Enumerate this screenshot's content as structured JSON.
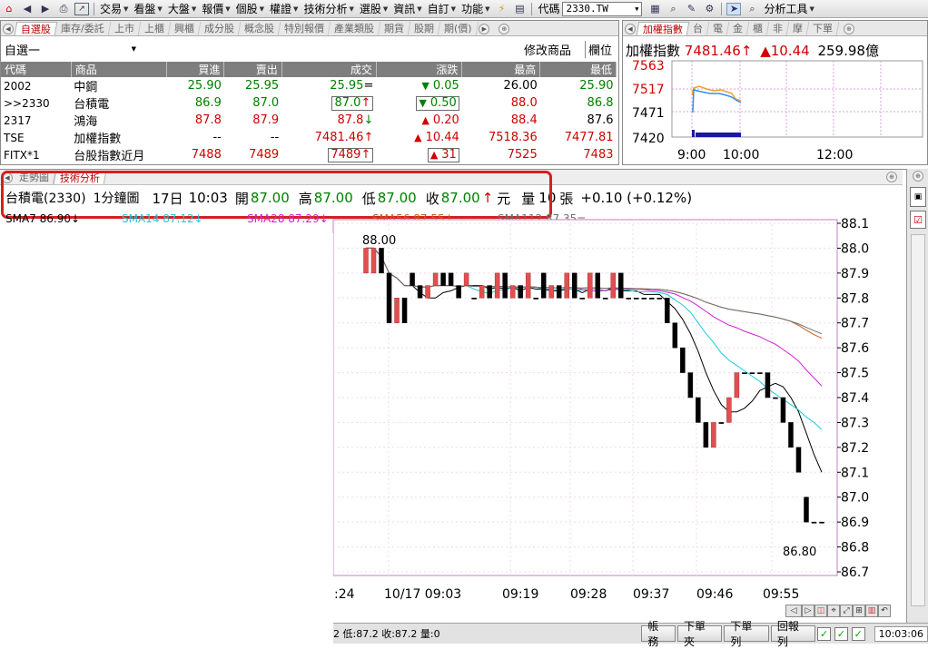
{
  "menubar": {
    "items": [
      "交易",
      "看盤",
      "大盤",
      "報價",
      "個股",
      "權證",
      "技術分析",
      "選股",
      "資訊",
      "自訂",
      "功能"
    ],
    "code_label": "代碼",
    "code_value": "2330.TW",
    "analysis_tools": "分析工具"
  },
  "watchlist": {
    "tabs": [
      "自選股",
      "庫存/委託",
      "上市",
      "上櫃",
      "興櫃",
      "成分股",
      "概念股",
      "特別報價",
      "產業類股",
      "期貨",
      "股期",
      "期(價)"
    ],
    "list_name": "自選一",
    "modify_button": "修改商品",
    "column_button": "欄位",
    "headers": [
      "代碼",
      "商品",
      "買進",
      "賣出",
      "成交",
      "漲跌",
      "最高",
      "最低"
    ],
    "rows": [
      {
        "code": "2002",
        "name": "中鋼",
        "bid": "25.90",
        "ask": "25.95",
        "last": "25.95",
        "last_sym": "=",
        "chg_arrow": "▼",
        "chg": "0.05",
        "high": "26.00",
        "low": "25.90",
        "c_bid": "g",
        "c_ask": "g",
        "c_last": "g",
        "c_chg": "g",
        "c_high": "k",
        "c_low": "g",
        "box_last": false,
        "box_chg": false
      },
      {
        "code": ">>2330",
        "name": "台積電",
        "bid": "86.9",
        "ask": "87.0",
        "last": "87.0",
        "last_sym": "↑",
        "chg_arrow": "▼",
        "chg": "0.50",
        "high": "88.0",
        "low": "86.8",
        "c_bid": "g",
        "c_ask": "g",
        "c_last": "g",
        "c_chg": "g",
        "c_high": "r",
        "c_low": "g",
        "box_last": true,
        "box_chg": true
      },
      {
        "code": "2317",
        "name": "鴻海",
        "bid": "87.8",
        "ask": "87.9",
        "last": "87.8",
        "last_sym": "↓",
        "chg_arrow": "▲",
        "chg": "0.20",
        "high": "88.4",
        "low": "87.6",
        "c_bid": "r",
        "c_ask": "r",
        "c_last": "r",
        "c_chg": "r",
        "c_high": "r",
        "c_low": "k",
        "box_last": false,
        "box_chg": false
      },
      {
        "code": "TSE",
        "name": "加權指數",
        "bid": "--",
        "ask": "--",
        "last": "7481.46",
        "last_sym": "↑",
        "chg_arrow": "▲",
        "chg": "10.44",
        "high": "7518.36",
        "low": "7477.81",
        "c_bid": "k",
        "c_ask": "k",
        "c_last": "r",
        "c_chg": "r",
        "c_high": "r",
        "c_low": "r",
        "box_last": false,
        "box_chg": false
      },
      {
        "code": "FITX*1",
        "name": "台股指數近月",
        "bid": "7488",
        "ask": "7489",
        "last": "7489",
        "last_sym": "↑",
        "chg_arrow": "▲",
        "chg": "31",
        "high": "7525",
        "low": "7483",
        "c_bid": "r",
        "c_ask": "r",
        "c_last": "r",
        "c_chg": "r",
        "c_high": "r",
        "c_low": "r",
        "box_last": true,
        "box_chg": true
      }
    ]
  },
  "index_panel": {
    "tabs": [
      "加權指數",
      "台",
      "電",
      "金",
      "櫃",
      "非",
      "摩",
      "下單"
    ],
    "title": "加權指數",
    "value": "7481.46",
    "arrow": "↑",
    "change": "▲10.44",
    "volume": "259.98億",
    "y_ticks": [
      "7563",
      "7517",
      "7471",
      "7420"
    ],
    "x_ticks": [
      "9:00",
      "10:00",
      "12:00"
    ]
  },
  "chart": {
    "tabs": [
      "走勢圖",
      "技術分析"
    ],
    "info": {
      "name": "台積電(2330)",
      "period": "1分鐘圖",
      "date": "17日",
      "time": "10:03",
      "open_label": "開",
      "open": "87.00",
      "high_label": "高",
      "high": "87.00",
      "low_label": "低",
      "low": "87.00",
      "close_label": "收",
      "close": "87.00",
      "unit": "元",
      "vol_label": "量",
      "vol": "10",
      "vol_unit": "張",
      "change": "+0.10 (+0.12%)"
    },
    "ma_legend": [
      "SMA7 86.90↓",
      "SMA14 87.12↓",
      "SMA28 87.29↓",
      "SMA56 87.55↓",
      "SMA112 87.35="
    ],
    "ma_colors": [
      "#000000",
      "#1ec8d8",
      "#d020d0",
      "#c06020",
      "#707070"
    ],
    "y_ticks": [
      "88.1",
      "88.0",
      "87.9",
      "87.8",
      "87.7",
      "87.6",
      "87.5",
      "87.4",
      "87.3",
      "87.2",
      "87.1",
      "87.0",
      "86.9",
      "86.8",
      "86.7"
    ],
    "x_ticks": [
      ":24",
      "10/17 09:03",
      "09:19",
      "09:28",
      "09:37",
      "09:46",
      "09:55"
    ],
    "high_label": "88.00",
    "low_label": "86.80",
    "up_color": "#e05050",
    "down_color": "#000000"
  },
  "chart_data": {
    "type": "candlestick",
    "title": "台積電(2330) 1分鐘圖",
    "ylim": [
      86.7,
      88.1
    ],
    "open": [
      87.9,
      87.9,
      88.0,
      87.9,
      87.7,
      87.8,
      87.9,
      87.85,
      87.8,
      87.85,
      87.9,
      87.9,
      87.85,
      87.85,
      87.8,
      87.8,
      87.85,
      87.8,
      87.9,
      87.8,
      87.85,
      87.8,
      87.8,
      87.9,
      87.8,
      87.85,
      87.8,
      87.9,
      87.8,
      87.8,
      87.9,
      87.8,
      87.8,
      87.9,
      87.8,
      87.8,
      87.8,
      87.8,
      87.8,
      87.8,
      87.7,
      87.6,
      87.5,
      87.4,
      87.3,
      87.2,
      87.3,
      87.3,
      87.4,
      87.5,
      87.5,
      87.5,
      87.5,
      87.4,
      87.4,
      87.3,
      87.2,
      87.0,
      86.9,
      86.9
    ],
    "close": [
      88.0,
      88.0,
      87.9,
      87.7,
      87.8,
      87.7,
      87.85,
      87.8,
      87.85,
      87.9,
      87.85,
      87.85,
      87.8,
      87.9,
      87.8,
      87.85,
      87.8,
      87.9,
      87.8,
      87.85,
      87.8,
      87.9,
      87.8,
      87.8,
      87.85,
      87.8,
      87.9,
      87.8,
      87.8,
      87.9,
      87.8,
      87.8,
      87.9,
      87.8,
      87.8,
      87.8,
      87.8,
      87.8,
      87.8,
      87.7,
      87.6,
      87.5,
      87.4,
      87.3,
      87.2,
      87.3,
      87.3,
      87.4,
      87.5,
      87.5,
      87.5,
      87.5,
      87.4,
      87.4,
      87.3,
      87.2,
      87.1,
      86.9,
      86.9,
      86.9
    ]
  },
  "statusbar": {
    "info_text": "2 低:87.2 收:87.2 量:0",
    "buttons": [
      "帳務",
      "下單夾",
      "下單列",
      "回報列"
    ],
    "clock": "10:03:06"
  }
}
